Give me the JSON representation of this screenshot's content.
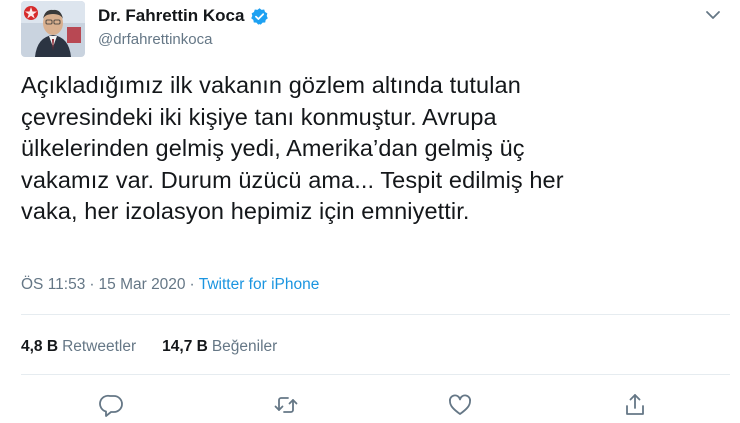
{
  "author": {
    "display_name": "Dr. Fahrettin Koca",
    "handle": "@drfahrettinkoca",
    "verified": true
  },
  "tweet": {
    "text": "Açıkladığımız ilk vakanın gözlem altında tutulan\nçevresindeki iki kişiye tanı konmuştur. Avrupa\nülkelerinden gelmiş yedi, Amerika’dan gelmiş üç\nvakamız var. Durum üzücü ama... Tespit edilmiş her\nvaka, her izolasyon hepimiz için emniyettir.",
    "time": "ÖS 11:53",
    "separator": "·",
    "date": "15 Mar 2020",
    "source": "Twitter for iPhone"
  },
  "stats": {
    "retweets_count": "4,8 B",
    "retweets_label": "Retweetler",
    "likes_count": "14,7 B",
    "likes_label": "Beğeniler"
  },
  "icons": {
    "verified": "verified-badge-icon",
    "menu": "chevron-down-icon",
    "reply": "reply-icon",
    "retweet": "retweet-icon",
    "like": "heart-icon",
    "share": "share-icon"
  },
  "colors": {
    "accent": "#1b95e0",
    "verified": "#1da1f2",
    "muted": "#657786",
    "text": "#14171a"
  }
}
